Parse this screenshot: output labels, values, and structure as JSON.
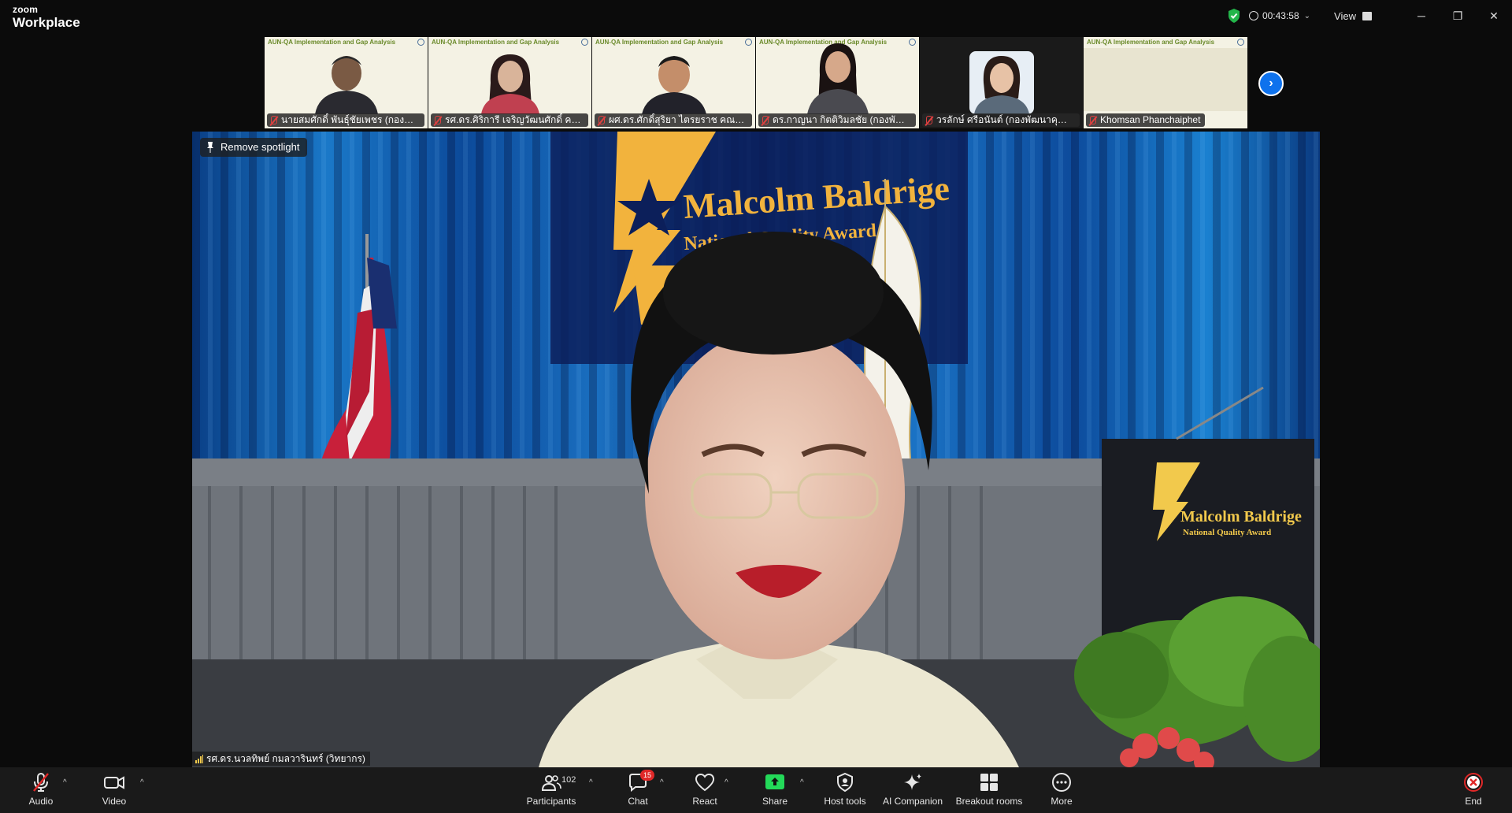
{
  "app": {
    "brand_small": "zoom",
    "brand_large": "Workplace"
  },
  "titlebar": {
    "timer": "00:43:58",
    "view_label": "View"
  },
  "thumbnails": [
    {
      "banner": "AUN-QA Implementation and Gap Analysis",
      "name": "นายสมศักดิ์ พันธ์ุชัยเพชร (กองพัฒนา..."
    },
    {
      "banner": "AUN-QA Implementation and Gap Analysis",
      "name": "รศ.ดร.ศิริการี เจริญวัฒนศักดิ์ คณะ..."
    },
    {
      "banner": "AUN-QA Implementation and Gap Analysis",
      "name": "ผศ.ดร.ศักดิ์สุริยา ไตรยราช คณะบริ..."
    },
    {
      "banner": "AUN-QA Implementation and Gap Analysis",
      "name": "ดร.กาญนา กิตติวิมลชัย (กองพัฒนา..."
    },
    {
      "banner": "",
      "name": "วรลักษ์ ศรีอนันต์ (กองพัฒนาคุณภ..."
    },
    {
      "banner": "AUN-QA Implementation and Gap Analysis",
      "name": "Khomsan Phanchaiphet"
    }
  ],
  "main": {
    "spotlight_label": "Remove spotlight",
    "speaker_name": "รศ.ดร.นวลทิพย์ กมลวารินทร์ (วิทยากร)",
    "banner_title": "Malcolm Baldrige",
    "banner_subtitle": "National Quality Award",
    "podium_title": "Malcolm Baldrige",
    "podium_subtitle": "National Quality Award"
  },
  "toolbar": {
    "audio": "Audio",
    "video": "Video",
    "participants": "Participants",
    "participants_count": "102",
    "chat": "Chat",
    "chat_badge": "15",
    "react": "React",
    "share": "Share",
    "host_tools": "Host tools",
    "ai_companion": "AI Companion",
    "breakout_rooms": "Breakout rooms",
    "more": "More",
    "end": "End"
  },
  "colors": {
    "accent": "#0e72ed",
    "share_green": "#23d959",
    "end_red": "#e02828",
    "shield_green": "#23b54a"
  }
}
